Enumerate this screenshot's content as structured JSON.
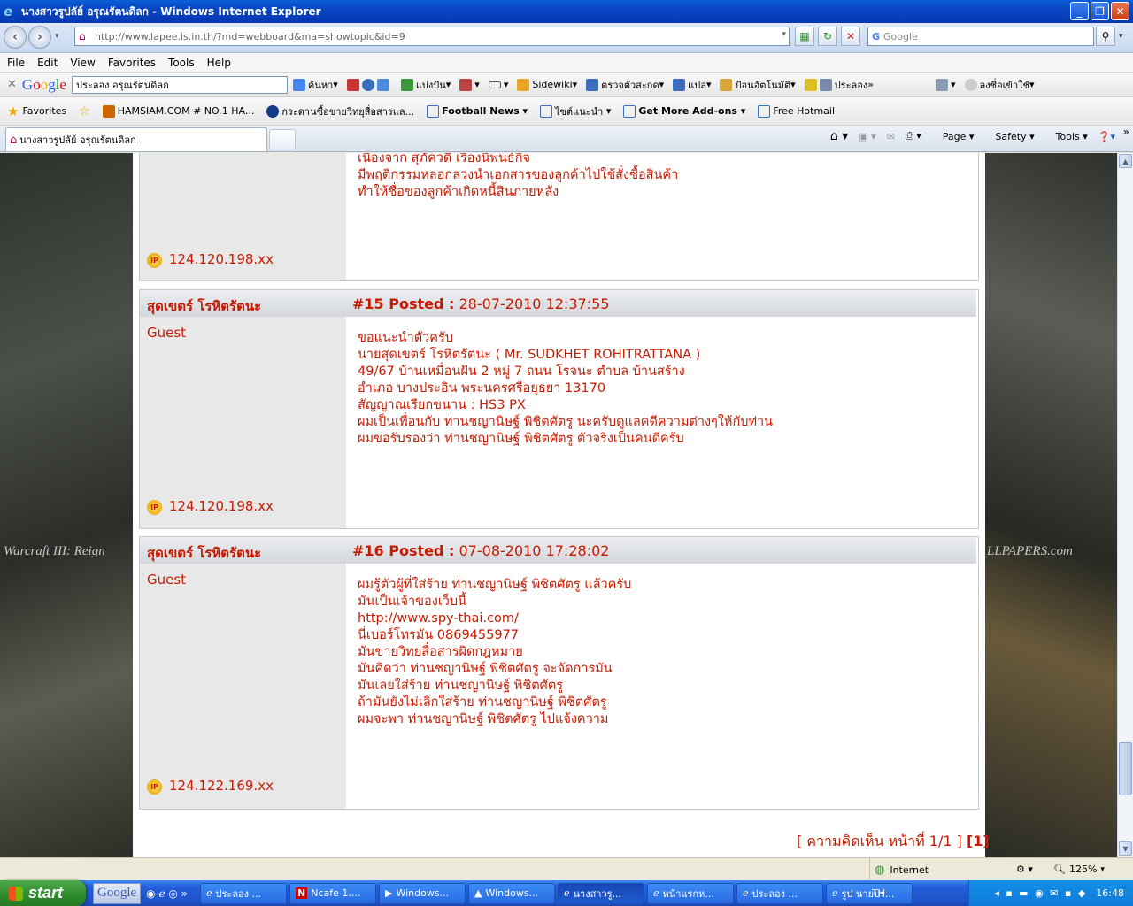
{
  "window": {
    "title": "นางสาวรูปลัย์ อรุณรัตนดิลก - Windows Internet Explorer",
    "btn_min": "_",
    "btn_max": "❐",
    "btn_close": "✕"
  },
  "addressbar": {
    "url": "http://www.lapee.is.in.th/?md=webboard&ma=showtopic&id=9",
    "search_placeholder": "Google"
  },
  "menu": {
    "file": "File",
    "edit": "Edit",
    "view": "View",
    "favorites": "Favorites",
    "tools": "Tools",
    "help": "Help"
  },
  "google_toolbar": {
    "logo": "Google",
    "query": "ประลอง อรุณรัตนดิลก",
    "search_label": "ค้นหา",
    "share_label": "แบ่งปัน",
    "sidewiki_label": "Sidewiki",
    "spell_label": "ตรวจตัวสะกด",
    "translate_label": "แปล",
    "autofill_label": "ป้อนอัตโนมัติ",
    "relay_label": "ประลอง",
    "signin_label": "ลงชื่อเข้าใช้"
  },
  "favorites_bar": {
    "favorites": "Favorites",
    "items": [
      "HAMSIAM.COM # NO.1 HA...",
      "กระดานซื้อขายวิทยุสื่อสารแล...",
      "Football News",
      "ไซต์แนะนำ",
      "Get More Add-ons",
      "Free Hotmail"
    ]
  },
  "tab": {
    "title": "นางสาวรูปลัย์ อรุณรัตนดิลก"
  },
  "commandbar": {
    "page": "Page",
    "safety": "Safety",
    "tools": "Tools"
  },
  "background": {
    "left_text": "Warcraft III: Reign",
    "right_text": "LLPAPERS.com"
  },
  "posts": [
    {
      "lines": [
        "เนื่องจาก สุภัควดี เรืองนิพนธ์กิจ",
        "มีพฤติกรรมหลอกลวงนำเอกสารของลูกค้าไปใช้สั่งซื้อสินค้า",
        "ทำให้ชื่อของลูกค้าเกิดหนี้สินภายหลัง"
      ],
      "ip_icon": "IP",
      "ip": "124.120.198.xx"
    },
    {
      "name": "สุดเขตร์ โรหิตรัตนะ",
      "number": "#15 Posted :",
      "datetime": "28-07-2010 12:37:55",
      "role": "Guest",
      "lines": [
        "ขอแนะนำตัวครับ",
        "นายสุดเขตร์ โรหิตรัตนะ ( Mr. SUDKHET ROHITRATTANA )",
        "49/67 บ้านเหมื่อนฝัน 2 หมู่ 7 ถนน โรจนะ ตำบล บ้านสร้าง",
        "อำเภอ บางประอิน พระนครศรีอยุธยา 13170",
        "สัญญาณเรียกขนาน : HS3 PX",
        "ผมเป็นเพื่อนกับ ท่านชญานิษฐ์ พิชิตศัตรู นะครับดูแลคดีความต่างๆให้กับท่าน",
        "ผมขอรับรองว่า ท่านชญานิษฐ์ พิชิตศัตรู ตัวจริงเป็นคนดีครับ"
      ],
      "ip_icon": "IP",
      "ip": "124.120.198.xx"
    },
    {
      "name": "สุดเขตร์ โรหิตรัตนะ",
      "number": "#16 Posted :",
      "datetime": "07-08-2010 17:28:02",
      "role": "Guest",
      "lines": [
        "ผมรู้ตัวผู้ที่ใส่ร้าย ท่านชญานิษฐ์ พิชิตศัตรู แล้วครับ",
        "มันเป็นเจ้าของเว็บนี้",
        "http://www.spy-thai.com/",
        "นี่เบอร์โทรมัน 0869455977",
        "มันขายวิทยสื่อสารผิดกฎหมาย",
        "มันคิดว่า ท่านชญานิษฐ์ พิชิตศัตรู จะจัดการมัน",
        "มันเลยใส่ร้าย ท่านชญานิษฐ์ พิชิตศัตรู",
        "ถ้ามันยังไม่เลิกใส่ร้าย ท่านชญานิษฐ์ พิชิตศัตรู",
        "ผมจะพา ท่านชญานิษฐ์ พิชิตศัตรู ไปแจ้งความ"
      ],
      "ip_icon": "IP",
      "ip": "124.122.169.xx"
    }
  ],
  "pager": {
    "text": "[ ความคิดเห็น หน้าที่ 1/1 ]",
    "current": "[1]"
  },
  "statusbar": {
    "zone": "Internet",
    "zoom": "125%"
  },
  "taskbar": {
    "start": "start",
    "google": "Google",
    "buttons": [
      "ประลอง ...",
      "Ncafe 1....",
      "Windows...",
      "Windows...",
      "นางสาวรู...",
      "หน้าแรกห...",
      "ประลอง ...",
      "รูป นายปร..."
    ],
    "lang": "TH",
    "clock": "16:48"
  }
}
